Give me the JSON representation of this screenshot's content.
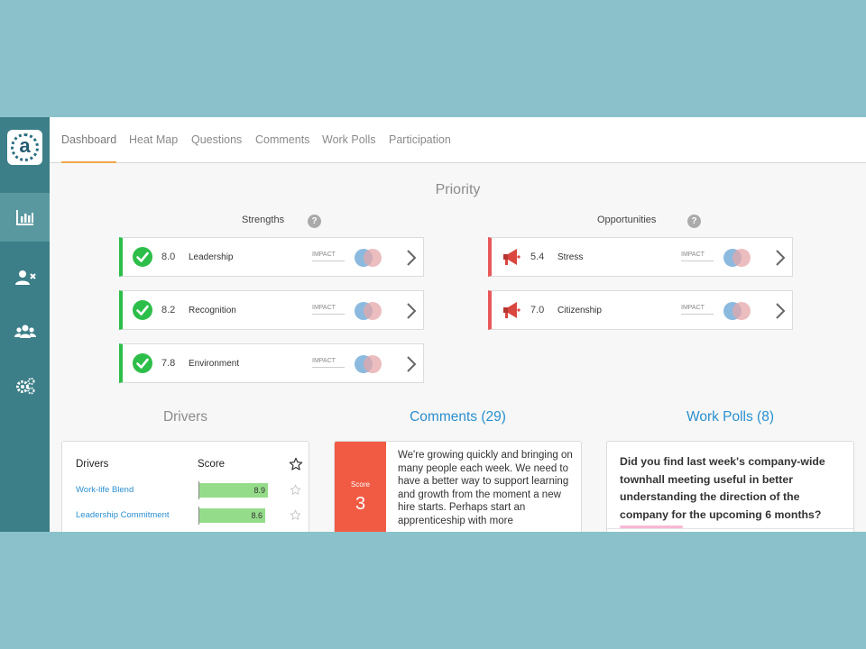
{
  "tabs": [
    {
      "label": "Dashboard",
      "active": true
    },
    {
      "label": "Heat Map"
    },
    {
      "label": "Questions"
    },
    {
      "label": "Comments"
    },
    {
      "label": "Work Polls"
    },
    {
      "label": "Participation"
    }
  ],
  "sidebar": {
    "logo_letter": "a",
    "items": [
      {
        "icon": "bar-chart-icon",
        "active": true
      },
      {
        "icon": "user-remove-icon"
      },
      {
        "icon": "group-icon"
      },
      {
        "icon": "gears-icon"
      }
    ]
  },
  "priority": {
    "title": "Priority",
    "strengths_label": "Strengths",
    "opportunities_label": "Opportunities",
    "help_glyph": "?",
    "impact_label": "IMPACT",
    "strengths": [
      {
        "score": "8.0",
        "label": "Leadership"
      },
      {
        "score": "8.2",
        "label": "Recognition"
      },
      {
        "score": "7.8",
        "label": "Environment"
      }
    ],
    "opportunities": [
      {
        "score": "5.4",
        "label": "Stress"
      },
      {
        "score": "7.0",
        "label": "Citizenship"
      }
    ]
  },
  "drivers": {
    "title": "Drivers",
    "col_drivers": "Drivers",
    "col_score": "Score",
    "rows": [
      {
        "name": "Work-life Blend",
        "score": "8.9",
        "fraction": 0.89
      },
      {
        "name": "Leadership Commitment",
        "score": "8.6",
        "fraction": 0.86
      }
    ]
  },
  "comments": {
    "title": "Comments (29)",
    "score_label": "Score",
    "score_value": "3",
    "text": "We're growing quickly and bringing on many people each week. We need to have a better way to support learning and growth from the moment a new hire starts. Perhaps start an apprenticeship with more"
  },
  "polls": {
    "title": "Work Polls (8)",
    "question": "Did you find last week's company-wide townhall meeting useful in better understanding the direction of the company for the upcoming 6 months?"
  },
  "colors": {
    "accent_tab": "#f0a64a",
    "strength": "#2dbe4a",
    "opportunity": "#e7595b",
    "link": "#2a8fd0",
    "score_box": "#f15b44",
    "sidebar": "#3c7f88"
  }
}
